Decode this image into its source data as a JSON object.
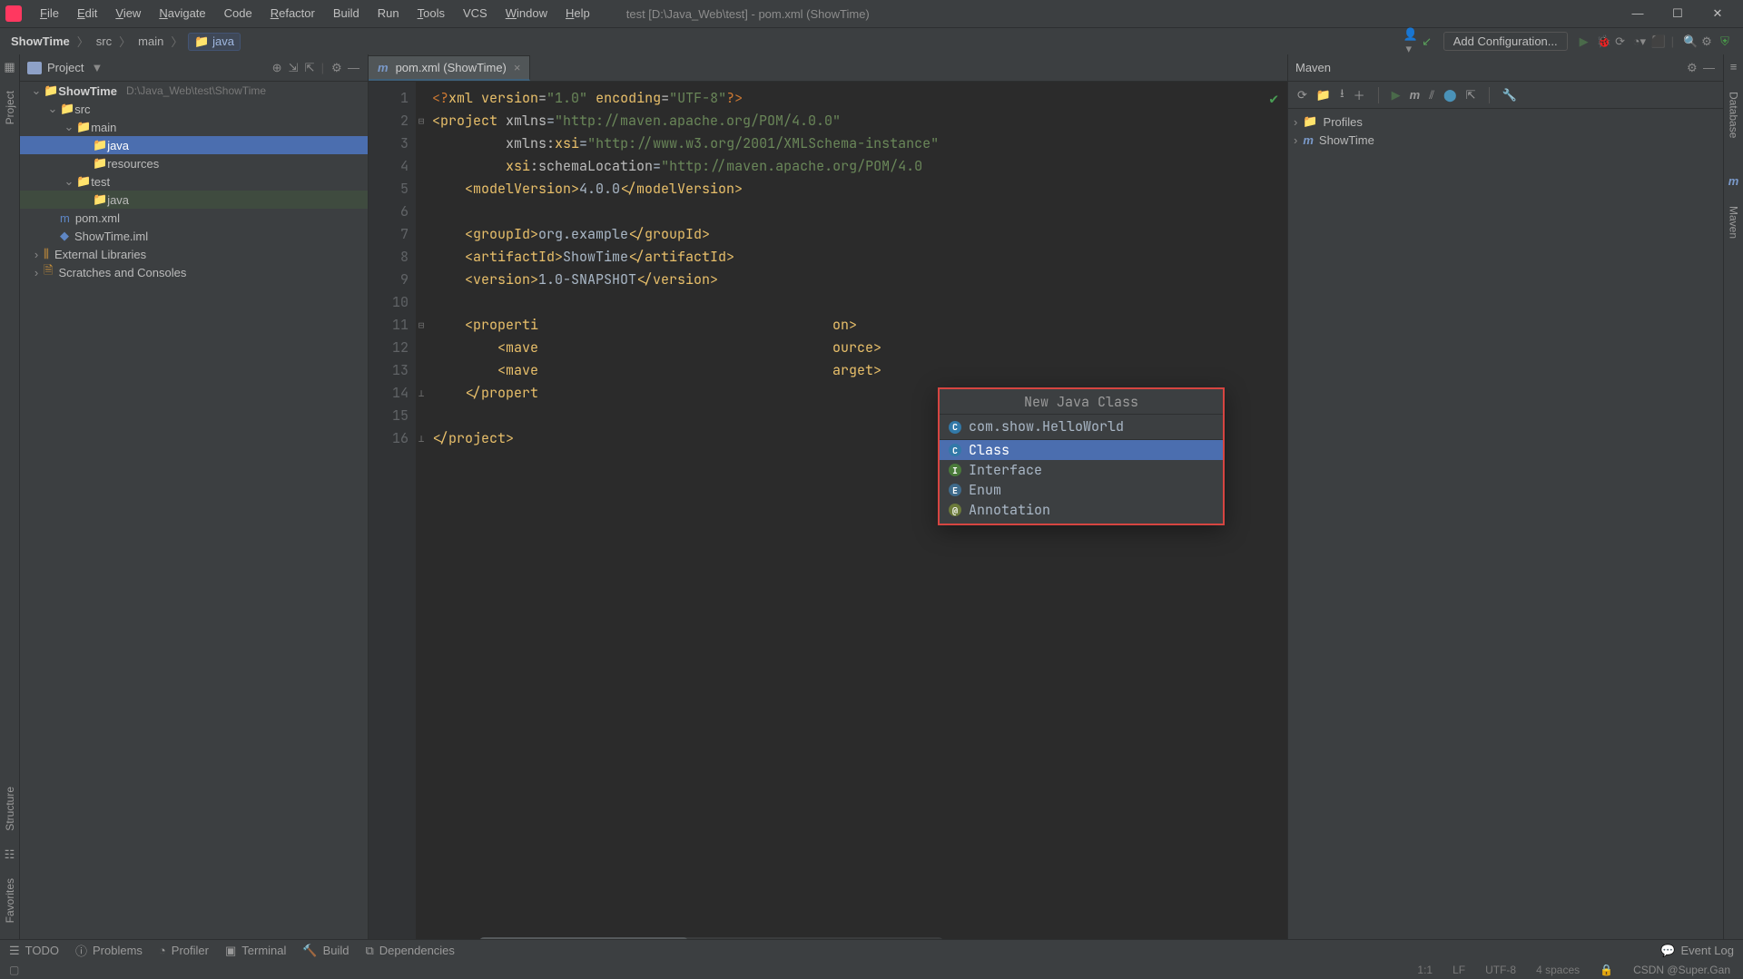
{
  "menubar": {
    "items": [
      "File",
      "Edit",
      "View",
      "Navigate",
      "Code",
      "Refactor",
      "Build",
      "Run",
      "Tools",
      "VCS",
      "Window",
      "Help"
    ],
    "title": "test [D:\\Java_Web\\test] - pom.xml (ShowTime)"
  },
  "toolbar": {
    "crumbs": [
      "ShowTime",
      "src",
      "main",
      "java"
    ],
    "run_config": "Add Configuration..."
  },
  "project": {
    "panel_title": "Project",
    "root_name": "ShowTime",
    "root_path": "D:\\Java_Web\\test\\ShowTime",
    "nodes": {
      "src": "src",
      "main": "main",
      "java_main": "java",
      "resources": "resources",
      "test": "test",
      "java_test": "java",
      "pom": "pom.xml",
      "iml": "ShowTime.iml",
      "ext_libs": "External Libraries",
      "scratches": "Scratches and Consoles"
    }
  },
  "tab": {
    "label": "pom.xml (ShowTime)"
  },
  "code_lines": {
    "1": "<?xml version=\"1.0\" encoding=\"UTF-8\"?>",
    "2": "<project xmlns=\"http://maven.apache.org/POM/4.0.0\"",
    "3": "         xmlns:xsi=\"http://www.w3.org/2001/XMLSchema-instance\"",
    "4": "         xsi:schemaLocation=\"http://maven.apache.org/POM/4.0",
    "5": "    <modelVersion>4.0.0</modelVersion>",
    "6": "",
    "7": "    <groupId>org.example</groupId>",
    "8": "    <artifactId>ShowTime</artifactId>",
    "9": "    <version>1.0-SNAPSHOT</version>",
    "10": "",
    "11": "    <properti",
    "11b": "on>",
    "12": "        <mave",
    "12b": "ource>",
    "13": "        <mave",
    "13b": "arget>",
    "14": "    </propert",
    "15": "",
    "16": "</project>"
  },
  "popup": {
    "title": "New Java Class",
    "input": "com.show.HelloWorld",
    "opts": [
      "Class",
      "Interface",
      "Enum",
      "Annotation"
    ]
  },
  "maven": {
    "title": "Maven",
    "profiles": "Profiles",
    "module": "ShowTime"
  },
  "left_gutter": {
    "project": "Project",
    "structure": "Structure",
    "favorites": "Favorites"
  },
  "right_gutter": {
    "database": "Database",
    "maven": "Maven"
  },
  "statusbar": {
    "todo": "TODO",
    "problems": "Problems",
    "profiler": "Profiler",
    "terminal": "Terminal",
    "build": "Build",
    "deps": "Dependencies",
    "eventlog": "Event Log"
  },
  "statusbar2": {
    "pos": "1:1",
    "le": "LF",
    "enc": "UTF-8",
    "indent": "4 spaces",
    "watermark": "CSDN @Super.Gan"
  }
}
